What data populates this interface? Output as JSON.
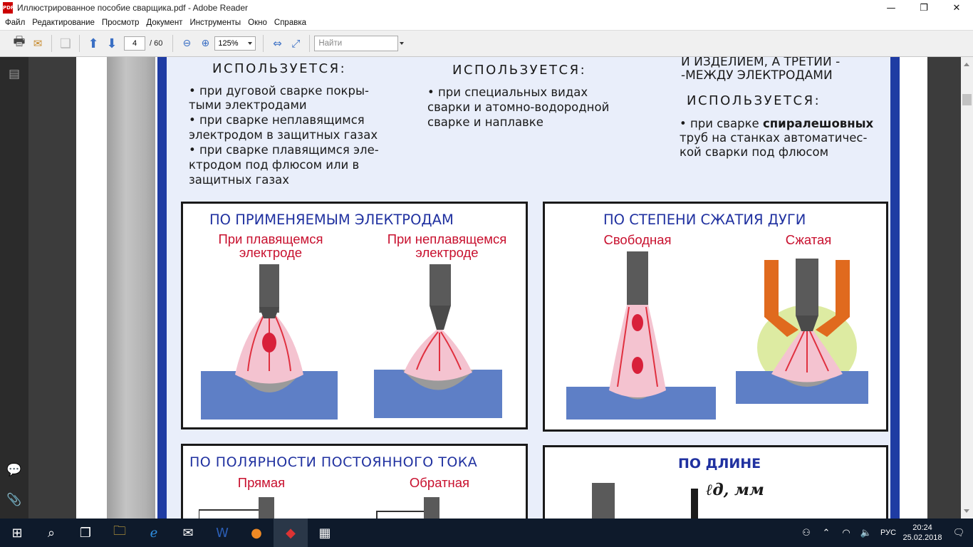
{
  "window": {
    "title": "Иллюстрированное пособие сварщика.pdf - Adobe Reader",
    "min_icon": "minimize-icon",
    "max_icon": "maximize-icon",
    "close_icon": "close-icon"
  },
  "menu": [
    "Файл",
    "Редактирование",
    "Просмотр",
    "Документ",
    "Инструменты",
    "Окно",
    "Справка"
  ],
  "toolbar": {
    "page_current": "4",
    "page_total": "/ 60",
    "zoom": "125%",
    "find_placeholder": "Найти"
  },
  "document": {
    "col1": {
      "header": "ИСПОЛЬЗУЕТСЯ:",
      "lines": [
        "•  при дуговой сварке покры-",
        "тыми электродами",
        "•  при сварке неплавящимся",
        "электродом в защитных газах",
        "•  при сварке плавящимся эле-",
        "ктродом под флюсом или в",
        "защитных газах"
      ]
    },
    "col2": {
      "header": "ИСПОЛЬЗУЕТСЯ:",
      "lines": [
        "•  при специальных видах",
        "сварки и атомно-водородной",
        "сварке и наплавке"
      ]
    },
    "col3": {
      "top_lines": [
        "И ИЗДЕЛИЕМ, А ТРЕТИЙ -",
        "-МЕЖДУ  ЭЛЕКТРОДАМИ"
      ],
      "header": "ИСПОЛЬЗУЕТСЯ:",
      "line1_prefix": "•  при сварке ",
      "line1_bold": "спиралешовных",
      "lines": [
        "труб на станках автоматичес-",
        "кой сварки под флюсом"
      ]
    },
    "panel_electrodes": {
      "title": "ПО ПРИМЕНЯЕМЫМ ЭЛЕКТРОДАМ",
      "left_label_1": "При плавящемся",
      "left_label_2": "электроде",
      "right_label_1": "При неплавящемся",
      "right_label_2": "электроде"
    },
    "panel_compression": {
      "title": "ПО СТЕПЕНИ СЖАТИЯ ДУГИ",
      "left_label": "Свободная",
      "right_label": "Сжатая"
    },
    "panel_polarity": {
      "title": "ПО ПОЛЯРНОСТИ ПОСТОЯННОГО ТОКА",
      "left_label": "Прямая",
      "right_label": "Обратная"
    },
    "panel_length": {
      "title": "ПО ДЛИНЕ",
      "symbol": "ℓд, мм"
    }
  },
  "taskbar": {
    "lang": "РУС",
    "time": "20:24",
    "date": "25.02.2018"
  },
  "colors": {
    "frame_blue": "#1f3ca3",
    "title_blue": "#2031a0",
    "label_red": "#c8102e",
    "metal_blue": "#5e7fc6"
  }
}
